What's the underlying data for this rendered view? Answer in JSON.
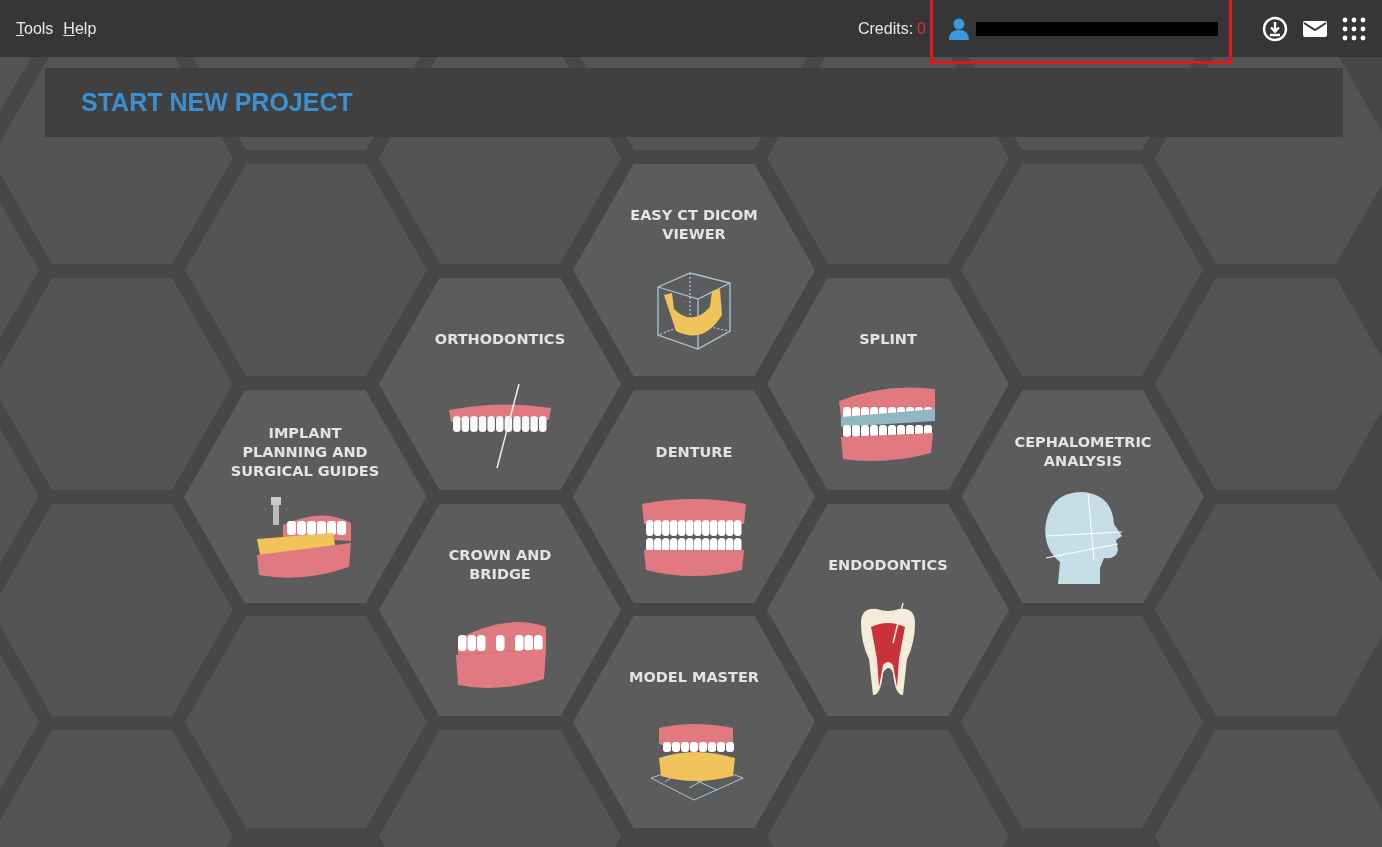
{
  "menu": [
    {
      "label": "Tools"
    },
    {
      "label": "Help"
    }
  ],
  "credits": {
    "label": "Credits:",
    "value": "0"
  },
  "account": {
    "highlighted": true
  },
  "banner": {
    "title": "START NEW PROJECT"
  },
  "tiles": [
    {
      "label": "EASY CT DICOM\nVIEWER"
    },
    {
      "label": "ORTHODONTICS"
    },
    {
      "label": "SPLINT"
    },
    {
      "label": "IMPLANT\nPLANNING AND\nSURGICAL GUIDES"
    },
    {
      "label": "DENTURE"
    },
    {
      "label": "CEPHALOMETRIC\nANALYSIS"
    },
    {
      "label": "CROWN AND\nBRIDGE"
    },
    {
      "label": "ENDODONTICS"
    },
    {
      "label": "MODEL MASTER"
    }
  ]
}
